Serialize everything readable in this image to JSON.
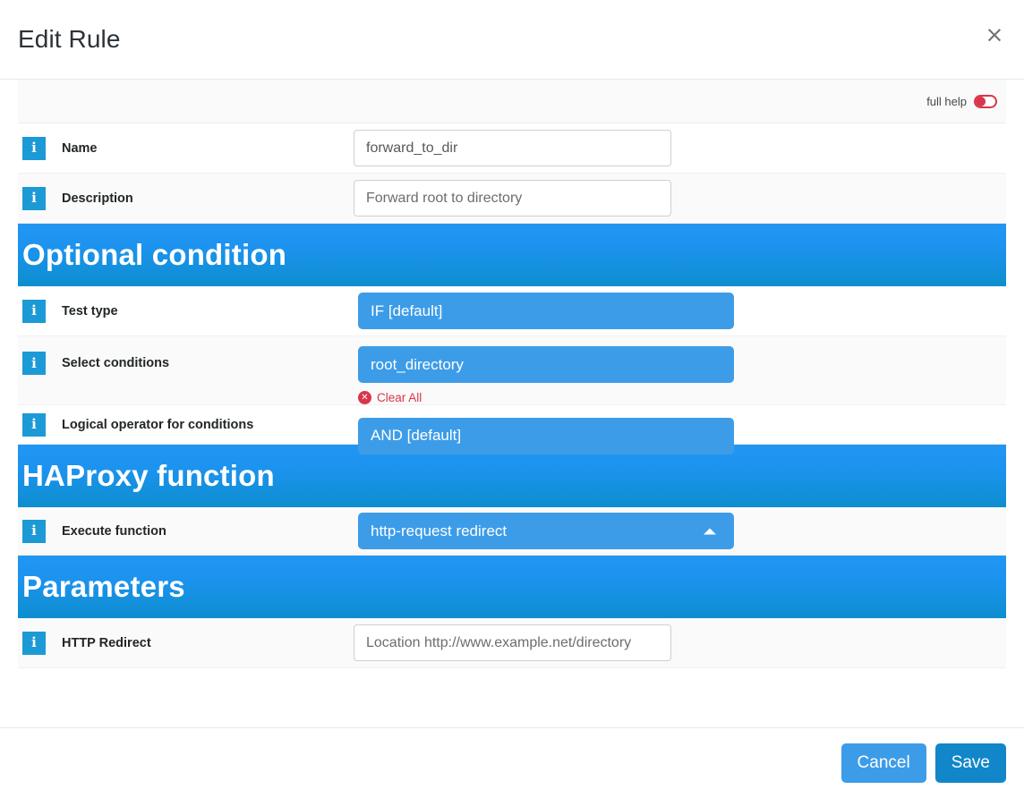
{
  "dialog": {
    "title": "Edit Rule",
    "close_icon": "close-icon",
    "close_glyph": "×"
  },
  "helpbar": {
    "label": "full help",
    "toggle_state": "off",
    "toggle_color": "#d9354a"
  },
  "colors": {
    "info_icon": "#1c9ad6",
    "select_blue": "#3d9ce8",
    "section_gradient_top": "#2196f3",
    "section_gradient_bottom": "#0d8ecf",
    "accent_red": "#d9354a",
    "save_blue": "#1187c9",
    "cancel_blue": "#3d9ce8"
  },
  "fields": {
    "name": {
      "label": "Name",
      "value": "forward_to_dir",
      "placeholder": "forward_to_dir",
      "info_icon": "info-icon"
    },
    "description": {
      "label": "Description",
      "value": "",
      "placeholder": "Forward root to directory",
      "info_icon": "info-icon"
    },
    "test_type": {
      "label": "Test type",
      "value": "IF [default]",
      "info_icon": "info-icon"
    },
    "select_conditions": {
      "label": "Select conditions",
      "value": "root_directory",
      "clear_all_label": "Clear All",
      "clear_icon": "clear-circle-x-icon",
      "clear_glyph": "✕",
      "info_icon": "info-icon"
    },
    "logical_operator": {
      "label": "Logical operator for conditions",
      "value": "AND [default]",
      "info_icon": "info-icon"
    },
    "execute_function": {
      "label": "Execute function",
      "value": "http-request redirect",
      "caret_icon": "caret-up-icon",
      "info_icon": "info-icon"
    },
    "http_redirect": {
      "label": "HTTP Redirect",
      "value": "",
      "placeholder": "Location http://www.example.net/directory",
      "info_icon": "info-icon"
    }
  },
  "sections": {
    "optional_condition": "Optional condition",
    "haproxy_function": "HAProxy function",
    "parameters": "Parameters"
  },
  "footer": {
    "cancel_label": "Cancel",
    "save_label": "Save"
  }
}
